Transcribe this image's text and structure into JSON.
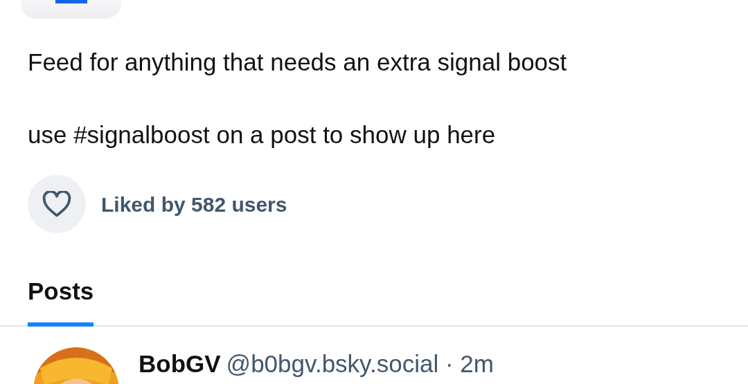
{
  "feed": {
    "description": [
      "Feed for anything that needs an extra signal boost",
      "use #signalboost on a post to show up here"
    ],
    "liked": false,
    "liked_by": "Liked by 582 users"
  },
  "tabs": [
    {
      "label": "Posts",
      "selected": true
    }
  ],
  "posts": [
    {
      "author": "BobGV",
      "handle": "@b0bgv.bsky.social · 2m"
    }
  ]
}
